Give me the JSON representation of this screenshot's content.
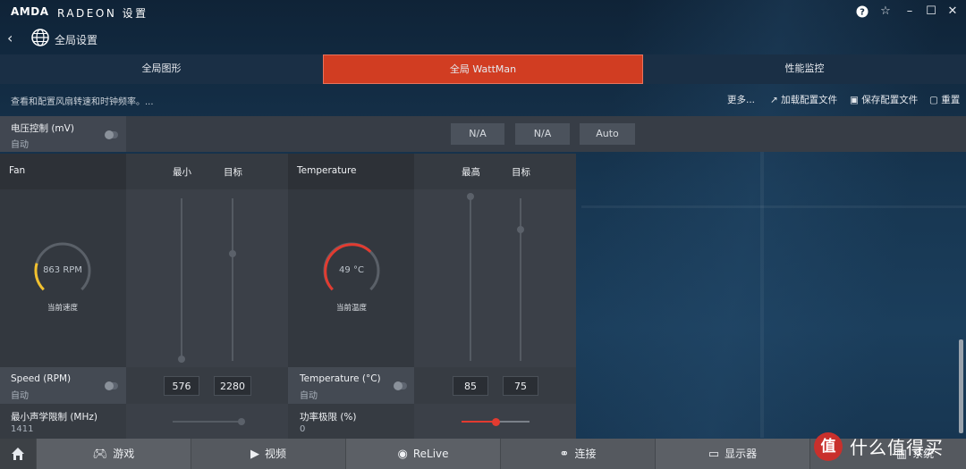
{
  "app": {
    "logo": "AMDA",
    "brand": "RADEON  设置"
  },
  "window": {
    "help": "?",
    "star": "☆",
    "minimize": "–",
    "maximize": "☐",
    "close": "✕"
  },
  "nav": {
    "back": "‹",
    "title": "全局设置"
  },
  "tabs": [
    {
      "label": "全局图形",
      "active": false
    },
    {
      "label": "全局 WattMan",
      "active": true
    },
    {
      "label": "性能监控",
      "active": false
    }
  ],
  "toolbar": {
    "description": "查看和配置风扇转速和时钟频率。...",
    "more": "更多...",
    "load_profile": "加载配置文件",
    "save_profile": "保存配置文件",
    "reset": "重置"
  },
  "voltage": {
    "title": "电压控制 (mV)",
    "mode": "自动",
    "values": [
      "N/A",
      "N/A",
      "Auto"
    ]
  },
  "fan": {
    "header": "Fan",
    "col_min": "最小",
    "col_target": "目标",
    "gauge_value": "863 RPM",
    "gauge_label": "当前速度",
    "speed_title": "Speed (RPM)",
    "speed_mode": "自动",
    "min_value": "576",
    "target_value": "2280",
    "acoustic_title": "最小声学限制 (MHz)",
    "acoustic_value": "1411"
  },
  "temperature": {
    "header": "Temperature",
    "col_max": "最高",
    "col_target": "目标",
    "gauge_value": "49 °C",
    "gauge_label": "当前温度",
    "temp_title": "Temperature (°C)",
    "temp_mode": "自动",
    "max_value": "85",
    "target_value": "75",
    "power_title": "功率极限 (%)",
    "power_value": "0"
  },
  "bottom_nav": [
    {
      "label": "游戏",
      "icon": "gamepad-icon"
    },
    {
      "label": "视频",
      "icon": "play-icon"
    },
    {
      "label": "ReLive",
      "icon": "relive-icon"
    },
    {
      "label": "连接",
      "icon": "connect-icon"
    },
    {
      "label": "显示器",
      "icon": "monitor-icon"
    },
    {
      "label": "系统",
      "icon": "system-icon"
    }
  ],
  "watermark": {
    "symbol": "值",
    "text": "什么值得买"
  },
  "colors": {
    "accent": "#d13d22",
    "fan_arc": "#f2c12e",
    "temp_arc": "#e23b30"
  }
}
